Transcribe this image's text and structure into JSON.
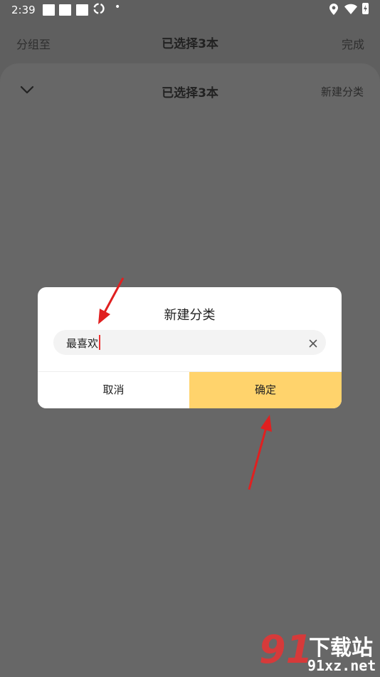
{
  "statusbar": {
    "time": "2:39",
    "icons": [
      "notification-square-icon",
      "notification-square-icon",
      "notification-square-icon",
      "sync-icon",
      "dot-icon",
      "location-icon",
      "wifi-icon",
      "battery-charging-icon"
    ]
  },
  "topbar": {
    "left_label": "分组至",
    "title": "已选择3本",
    "right_label": "完成"
  },
  "sheet": {
    "title": "已选择3本",
    "new_category_label": "新建分类",
    "collapse_icon": "chevron-down-icon"
  },
  "dialog": {
    "title": "新建分类",
    "input_value": "最喜欢",
    "clear_icon": "close-icon",
    "cancel_label": "取消",
    "confirm_label": "确定"
  },
  "colors": {
    "overlay_background": "#5f5f5f",
    "sheet_background": "#676767",
    "confirm_button": "#ffd36c",
    "annotation_arrow": "#e02020",
    "caret": "#e33333"
  },
  "watermark": {
    "number": "91",
    "cn_text": "下载站",
    "url": "91xz.net"
  }
}
